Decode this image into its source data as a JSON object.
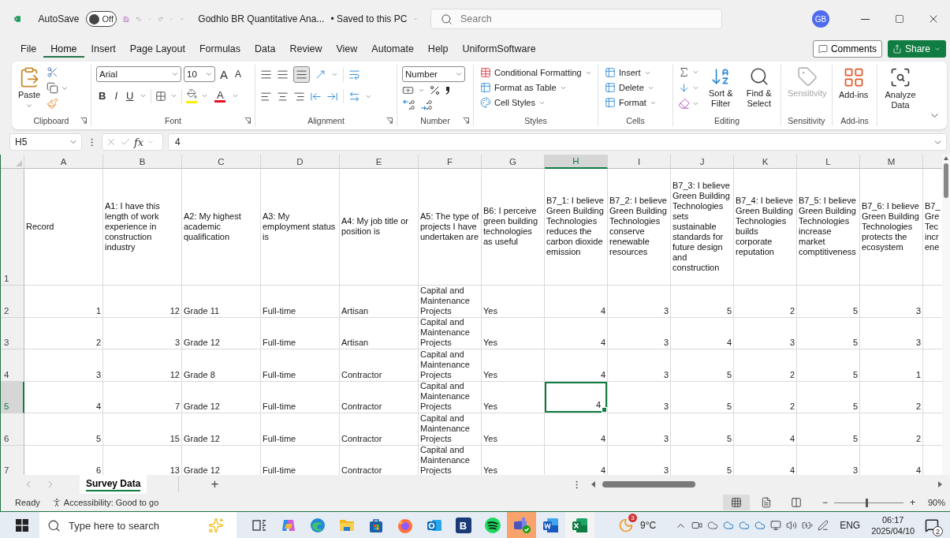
{
  "title_bar": {
    "autosave_label": "AutoSave",
    "autosave_on": false,
    "autosave_state": "Off",
    "document_title": "Godhlo BR Quantitative Ana...",
    "save_status": "• Saved to this PC",
    "search_placeholder": "Search",
    "avatar": "GB"
  },
  "menu_tabs": [
    {
      "label": "File",
      "selected": false
    },
    {
      "label": "Home",
      "selected": true
    },
    {
      "label": "Insert",
      "selected": false
    },
    {
      "label": "Page Layout",
      "selected": false
    },
    {
      "label": "Formulas",
      "selected": false
    },
    {
      "label": "Data",
      "selected": false
    },
    {
      "label": "Review",
      "selected": false
    },
    {
      "label": "View",
      "selected": false
    },
    {
      "label": "Automate",
      "selected": false
    },
    {
      "label": "Help",
      "selected": false
    },
    {
      "label": "UniformSoftware",
      "selected": false
    }
  ],
  "comments_button": "Comments",
  "share_button": "Share",
  "ribbon": {
    "clipboard": {
      "paste": "Paste",
      "label": "Clipboard"
    },
    "font": {
      "name": "Arial",
      "size": "10",
      "grow": "A",
      "shrink": "A",
      "bold": "B",
      "italic": "I",
      "underline": "U",
      "font_color": "A",
      "label": "Font"
    },
    "alignment": {
      "label": "Alignment"
    },
    "number": {
      "format": "Number",
      "label": "Number"
    },
    "styles": {
      "items": [
        "Conditional Formatting",
        "Format as Table",
        "Cell Styles"
      ],
      "label": "Styles"
    },
    "cells": {
      "items": [
        "Insert",
        "Delete",
        "Format"
      ],
      "label": "Cells"
    },
    "editing": {
      "sort": "Sort & Filter",
      "find": "Find & Select",
      "label": "Editing"
    },
    "sensitivity": {
      "button": "Sensitivity",
      "disabled": true,
      "label": "Sensitivity"
    },
    "addins": {
      "button": "Add-ins",
      "label": "Add-ins"
    },
    "analyze": {
      "button": "Analyze Data"
    }
  },
  "formula_bar": {
    "name_box": "H5",
    "fx": "fx",
    "formula": "4"
  },
  "sheet": {
    "columns": [
      {
        "letter": "A",
        "numeric": true,
        "selected": false
      },
      {
        "letter": "B",
        "numeric": true,
        "selected": false
      },
      {
        "letter": "C",
        "numeric": false,
        "selected": false
      },
      {
        "letter": "D",
        "numeric": false,
        "selected": false
      },
      {
        "letter": "E",
        "numeric": false,
        "selected": false
      },
      {
        "letter": "F",
        "numeric": false,
        "selected": false
      },
      {
        "letter": "G",
        "numeric": false,
        "selected": false
      },
      {
        "letter": "H",
        "numeric": true,
        "selected": true
      },
      {
        "letter": "I",
        "numeric": true,
        "selected": false
      },
      {
        "letter": "J",
        "numeric": true,
        "selected": false
      },
      {
        "letter": "K",
        "numeric": true,
        "selected": false
      },
      {
        "letter": "L",
        "numeric": true,
        "selected": false
      },
      {
        "letter": "M",
        "numeric": true,
        "selected": false
      }
    ],
    "partial_column_heading": "B7_ Gre Tec incr ene",
    "header_row": {
      "number": "1",
      "cells": [
        "Record",
        "A1: I have this length of work experience in construction industry",
        "A2: My highest academic qualification",
        "A3: My employment status is",
        "A4: My job title or position is",
        "A5: The type of projects I have undertaken are",
        "B6: I perceive green building technologies as useful",
        "B7_1: I believe Green Building Technologies reduces the carbon dioxide emission",
        "B7_2: I believe Green Building Technologies conserve renewable resources",
        "B7_3: I believe Green Building Technologies sets sustainable standards for future design and construction",
        "B7_4: I believe Green Building Technologies builds corporate reputation",
        "B7_5: I believe Green Building Technologies increase market comptitiveness",
        "B7_6: I believe Green Building Technologies protects the ecosystem"
      ]
    },
    "rows": [
      {
        "number": "2",
        "selected": false,
        "cells": [
          "1",
          "12",
          "Grade 11",
          "Full-time",
          "Artisan",
          "Capital and Maintenance Projects",
          "Yes",
          "4",
          "3",
          "5",
          "2",
          "5",
          "3"
        ]
      },
      {
        "number": "3",
        "selected": false,
        "cells": [
          "2",
          "3",
          "Grade 12",
          "Full-time",
          "Artisan",
          "Capital and Maintenance Projects",
          "Yes",
          "4",
          "3",
          "4",
          "3",
          "5",
          "3"
        ]
      },
      {
        "number": "4",
        "selected": false,
        "cells": [
          "3",
          "12",
          "Grade 8",
          "Full-time",
          "Contractor",
          "Capital and Maintenance Projects",
          "Yes",
          "4",
          "3",
          "5",
          "2",
          "5",
          "1"
        ]
      },
      {
        "number": "5",
        "selected": true,
        "cells": [
          "4",
          "7",
          "Grade 12",
          "Full-time",
          "Contractor",
          "Capital and Maintenance Projects",
          "Yes",
          "4",
          "3",
          "5",
          "2",
          "5",
          "2"
        ]
      },
      {
        "number": "6",
        "selected": false,
        "cells": [
          "5",
          "15",
          "Grade 12",
          "Full-time",
          "Contractor",
          "Capital and Maintenance Projects",
          "Yes",
          "4",
          "3",
          "5",
          "4",
          "5",
          "2"
        ]
      },
      {
        "number": "7",
        "selected": false,
        "cells": [
          "6",
          "13",
          "Grade 12",
          "Full-time",
          "Contractor",
          "Capital and Maintenance Projects",
          "Yes",
          "4",
          "3",
          "5",
          "4",
          "3",
          "4"
        ]
      }
    ]
  },
  "sheet_tabs": [
    {
      "label": "Survey Data",
      "selected": true
    }
  ],
  "add_sheet": "+",
  "status_bar": {
    "ready": "Ready",
    "accessibility": "Accessibility: Good to go",
    "views": [
      {
        "kind": "normal",
        "selected": true
      },
      {
        "kind": "page_layout",
        "selected": false
      },
      {
        "kind": "page_break",
        "selected": false
      }
    ],
    "zoom_minus": "−",
    "zoom_plus": "+",
    "zoom": {
      "level": 0.47,
      "reading": "90%"
    }
  },
  "taskbar": {
    "search_placeholder": "Type here to search",
    "apps": [
      {
        "kind": "task_view",
        "flashing": false,
        "active": false
      },
      {
        "kind": "copilot",
        "flashing": false,
        "active": false
      },
      {
        "kind": "edge",
        "flashing": false,
        "active": false
      },
      {
        "kind": "explorer",
        "flashing": false,
        "active": false
      },
      {
        "kind": "store",
        "flashing": false,
        "active": false
      },
      {
        "kind": "firefox",
        "flashing": false,
        "active": false
      },
      {
        "kind": "outlook",
        "flashing": false,
        "active": false
      },
      {
        "kind": "lettered",
        "label": "B",
        "flashing": false,
        "active": false
      },
      {
        "kind": "spotify",
        "flashing": false,
        "active": false
      },
      {
        "kind": "teams",
        "flashing": true,
        "active": false
      },
      {
        "kind": "word",
        "flashing": false,
        "active": false
      },
      {
        "kind": "excel",
        "flashing": false,
        "active": true
      }
    ],
    "weather": {
      "badge": "3",
      "temperature": "9°C"
    },
    "language": "ENG",
    "time": "06:17",
    "date": "2025/04/10",
    "notifications": "2"
  }
}
